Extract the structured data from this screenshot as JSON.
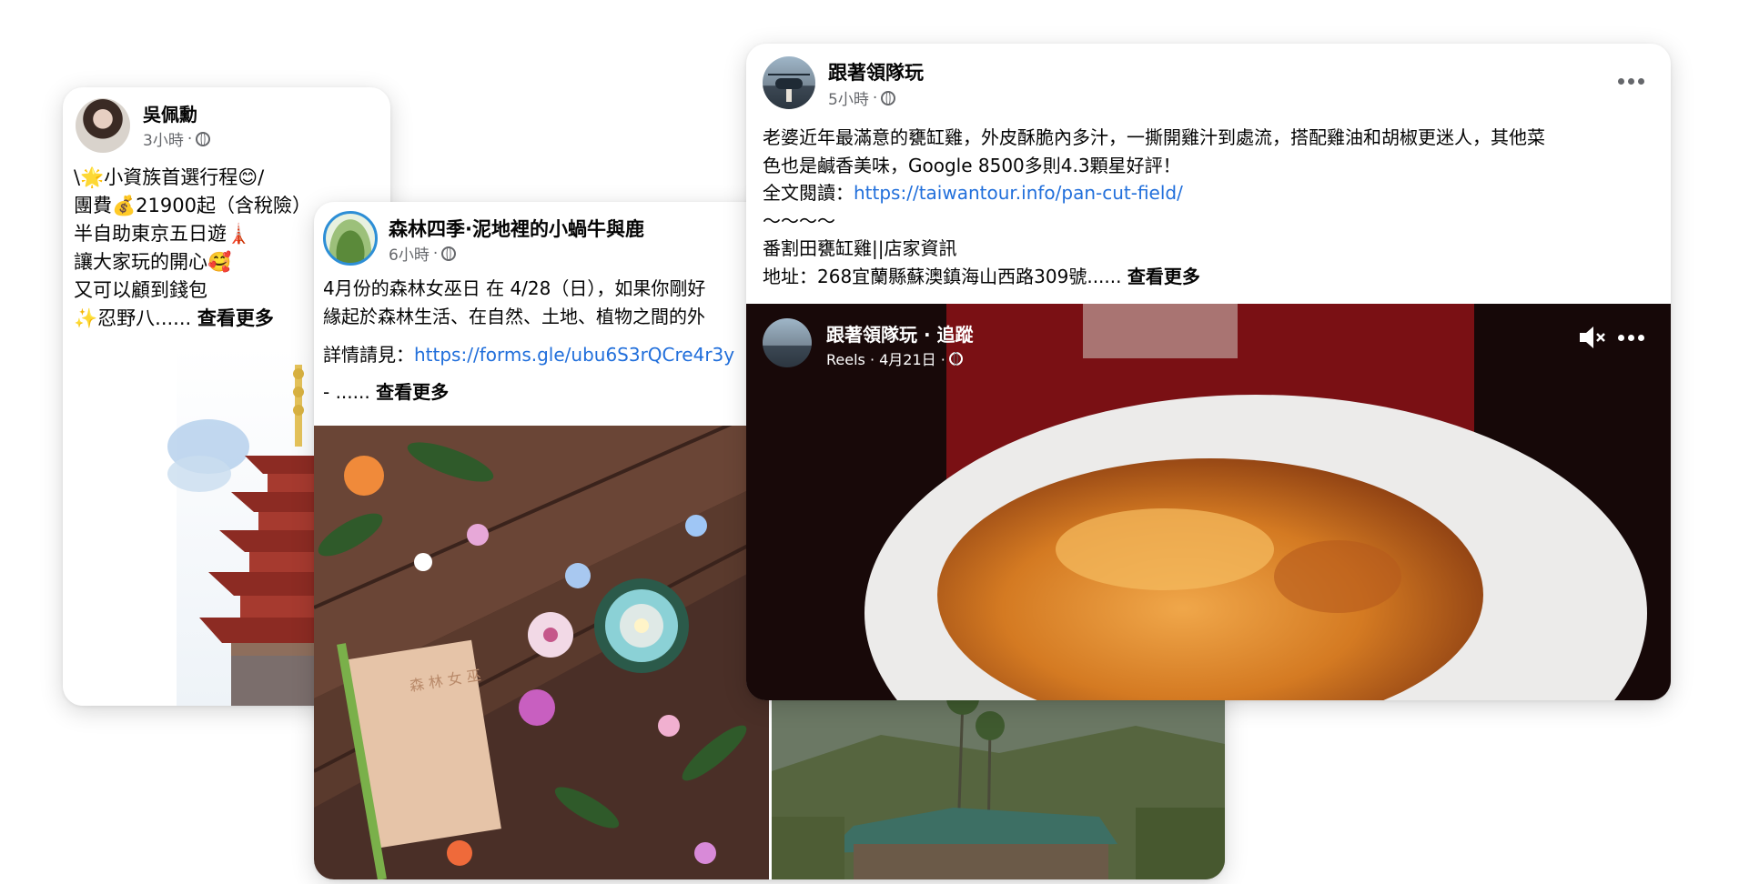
{
  "post1": {
    "author": "吳佩勳",
    "time": "3小時",
    "dot": "·",
    "lines": [
      "\\🌟小資族首選行程😊/",
      "團費💰21900起（含稅險）",
      "半自助東京五日遊🗼",
      "讓大家玩的開心🥰",
      "又可以顧到錢包",
      "✨忍野八......"
    ],
    "see_more": "查看更多"
  },
  "post2": {
    "author": "森林四季·泥地裡的小蝸牛與鹿",
    "time": "6小時",
    "dot": "·",
    "line1": "4月份的森林女巫日 在 4/28（日），如果你剛好",
    "line2": "緣起於森林生活、在自然、土地、植物之間的外",
    "details_label": "詳情請見：",
    "details_link": "https://forms.gle/ubu6S3rQCre4r3y",
    "dash": "- ......",
    "see_more": "查看更多",
    "card_text": "森 林 女 巫"
  },
  "post3": {
    "author": "跟著領隊玩",
    "time": "5小時",
    "dot": "·",
    "line1": "老婆近年最滿意的甕缸雞，外皮酥脆內多汁，一撕開雞汁到處流，搭配雞油和胡椒更迷人，其他菜",
    "line2": "色也是鹹香美味，Google 8500多則4.3顆星好評！",
    "read_label": "全文閱讀：",
    "read_link": "https://taiwantour.info/pan-cut-field/",
    "tilde": "～～～～",
    "shop": "番割田甕缸雞||店家資訊",
    "address": "地址：268宜蘭縣蘇澳鎮海山西路309號......",
    "see_more": "查看更多",
    "reel": {
      "author": "跟著領隊玩",
      "follow": "· 追蹤",
      "meta": "Reels · 4月21日 ·"
    }
  },
  "colors": {
    "link": "#216fdb",
    "meta": "#65676b"
  }
}
